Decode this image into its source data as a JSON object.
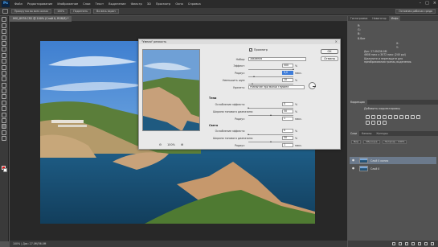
{
  "app": {
    "logo": "Ps",
    "menu": [
      "Файл",
      "Редактирование",
      "Изображение",
      "Слои",
      "Текст",
      "Выделение",
      "Фильтр",
      "3D",
      "Просмотр",
      "Окно",
      "Справка"
    ],
    "window_controls": [
      "–",
      "□",
      "×"
    ]
  },
  "options_bar": {
    "buttons": [
      "Прокрутка во всех окнах",
      "100%",
      "Подогнать",
      "Во весь экран"
    ],
    "workspace": "Основная рабочая среда"
  },
  "document": {
    "tab_title": "IMG_8978.CR2 @ 100% (Слой 0, RGB/8) *",
    "status": "100% | Док: 27.0M/36.0M"
  },
  "dialog": {
    "title": "\"Умная\" резкость",
    "preview_label": "Просмотр",
    "preview_checked": "✓",
    "close": "×",
    "zoom_out": "⊖",
    "zoom_in": "⊕",
    "zoom_level": "100%",
    "ok": "OK",
    "cancel": "Отмена",
    "preset": {
      "label": "Набор:",
      "value": "Заказная"
    },
    "amount": {
      "label": "Эффект:",
      "value": "500",
      "unit": "%",
      "level": 1.0
    },
    "radius": {
      "label": "Радиус:",
      "value": "9,0",
      "unit": "пикс.",
      "level": 0.14
    },
    "noise": {
      "label": "Уменьшить шум:",
      "value": "10",
      "unit": "%",
      "level": 0.1
    },
    "remove": {
      "label": "Удалить:",
      "value": "Размытие при малой глубине"
    },
    "shadow_head": "Тени",
    "shadow_fade": {
      "label": "Ослабление эффекта:",
      "value": "0",
      "unit": "%",
      "level": 0
    },
    "shadow_tonal": {
      "label": "Ширина тонового диапазона:",
      "value": "50",
      "unit": "%",
      "level": 0.5
    },
    "shadow_radius": {
      "label": "Радиус:",
      "value": "1",
      "unit": "пикс.",
      "level": 0.01
    },
    "highlight_head": "Света",
    "highlight_fade": {
      "label": "Ослабление эффекта:",
      "value": "0",
      "unit": "%",
      "level": 0
    },
    "highlight_tonal": {
      "label": "Ширина тонового диапазона:",
      "value": "50",
      "unit": "%",
      "level": 0.5
    },
    "highlight_radius": {
      "label": "Радиус:",
      "value": "1",
      "unit": "пикс.",
      "level": 0.01
    }
  },
  "right_panel": {
    "top_tabs": [
      "Гистограмма",
      "Навигатор",
      "Инфо"
    ],
    "info_rows": [
      "R:",
      "G:",
      "B:",
      "8-бит",
      "X:",
      "Y:"
    ],
    "info_lines": [
      "Док: 27.0M/36.0M",
      "4608 пикс x 3072 пикс (240 ppi)",
      "Щелкните и перетащите для",
      "преобразования границ выделения."
    ],
    "adjustments_tab": "Коррекция",
    "adjustments_title": "Добавить корректировку",
    "layers_tabs": [
      "Слои",
      "Каналы",
      "Контуры"
    ],
    "layers_kind": "Вид",
    "layers_mode": "Обычные",
    "layers_opacity": "Непрозр.: 100%",
    "layers": [
      {
        "name": "Слой 0 копия",
        "selected": true
      },
      {
        "name": "Слой 0",
        "selected": false
      }
    ],
    "eye": "●"
  }
}
